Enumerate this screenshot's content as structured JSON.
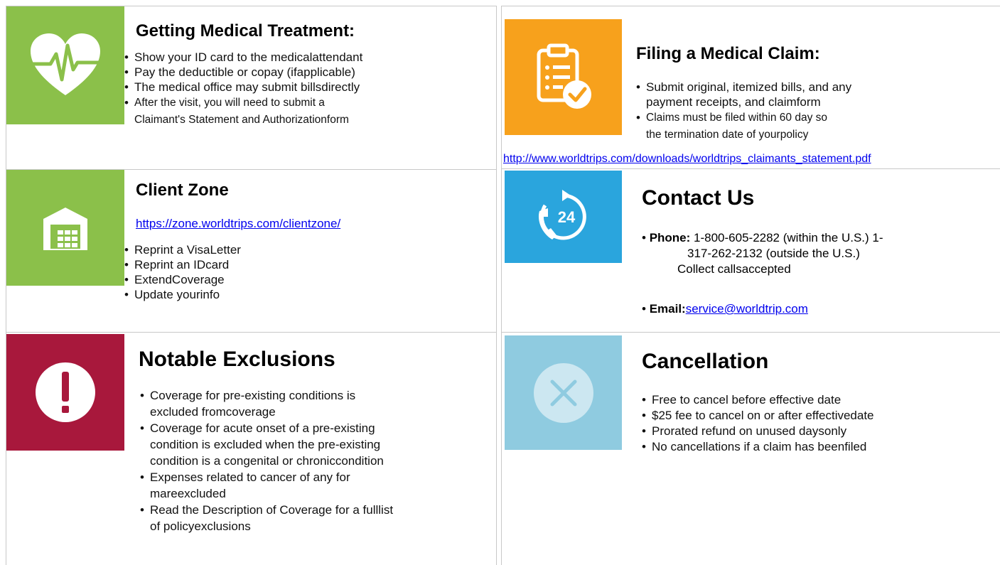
{
  "colors": {
    "green": "#8bc04a",
    "orange": "#f7a11c",
    "blue": "#2aa5dd",
    "crimson": "#a8183c",
    "lightblue": "#8fcbe0",
    "link": "#0000ee"
  },
  "medical_treatment": {
    "icon": "heartbeat-icon",
    "title": "Getting Medical Treatment:",
    "items": [
      "Show your ID card to the medicalattendant",
      "Pay the deductible or copay (ifapplicable)",
      "The medical office may submit billsdirectly"
    ],
    "item4_line1": "After the visit, you will need to submit a",
    "item4_line2": "Claimant's Statement and Authorizationform"
  },
  "medical_claim": {
    "icon": "clipboard-check-icon",
    "title": "Filing a Medical Claim:",
    "item1_line1": "Submit original, itemized bills, and any",
    "item1_line2": "payment receipts, and claimform",
    "item2_line1": "Claims must be filed within 60 day so",
    "item2_line2": "the termination date of yourpolicy",
    "link": "http://www.worldtrips.com/downloads/worldtrips_claimants_statement.pdf"
  },
  "client_zone": {
    "icon": "building-icon",
    "title": "Client Zone",
    "link": "https://zone.worldtrips.com/clientzone/",
    "items": [
      "Reprint a VisaLetter",
      "Reprint an IDcard",
      "ExtendCoverage",
      "Update yourinfo"
    ]
  },
  "contact": {
    "icon": "phone-24-icon",
    "title": "Contact Us",
    "phone_label": "Phone:",
    "phone_line1": "1-800-605-2282 (within the U.S.) 1-",
    "phone_line2": "317-262-2132 (outside the U.S.)",
    "phone_line3": "Collect callsaccepted",
    "email_label": "Email:",
    "email": "service@worldtrip.com"
  },
  "exclusions": {
    "icon": "exclamation-icon",
    "title": "Notable Exclusions",
    "item1_line1": "Coverage for pre-existing conditions is",
    "item1_line2": "excluded fromcoverage",
    "item2_line1": "Coverage for acute onset of a pre-existing",
    "item2_line2": "condition is excluded when the pre-existing",
    "item2_line3": "condition is a congenital or chroniccondition",
    "item3_line1": "Expenses related to cancer of any for",
    "item3_line2": "mareexcluded",
    "item4_line1": "Read the Description of Coverage for a fulllist",
    "item4_line2": "of policyexclusions"
  },
  "cancellation": {
    "icon": "x-circle-icon",
    "title": "Cancellation",
    "items": [
      "Free to cancel before effective date",
      "$25 fee to cancel on or after effectivedate",
      "Prorated refund on unused daysonly",
      "No cancellations if a claim has beenfiled"
    ]
  }
}
